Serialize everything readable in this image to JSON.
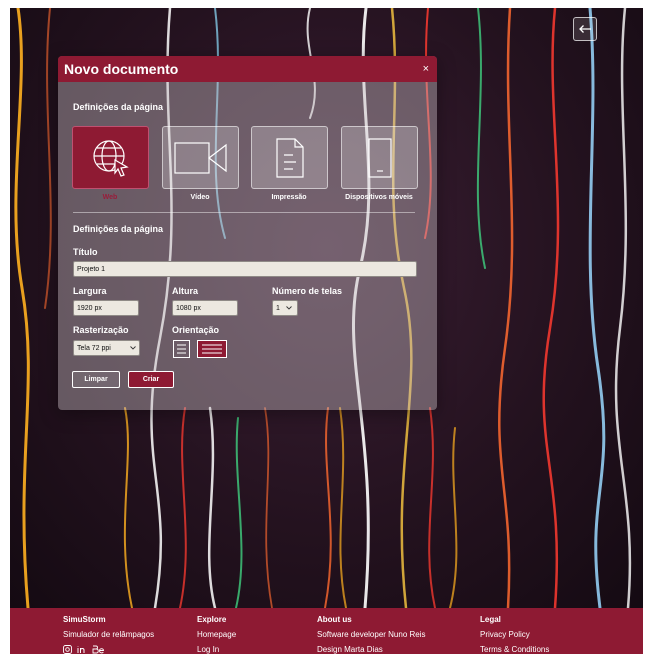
{
  "dialog": {
    "title": "Novo documento",
    "close": "×",
    "section_page_settings": "Definições da página",
    "section_page_settings_2": "Definições da página",
    "doc_types": [
      {
        "label": "Web",
        "icon": "web-cursor-icon",
        "selected": true
      },
      {
        "label": "Vídeo",
        "icon": "video-camera-icon",
        "selected": false
      },
      {
        "label": "Impressão",
        "icon": "document-icon",
        "selected": false
      },
      {
        "label": "Dispositivos móveis",
        "icon": "mobile-device-icon",
        "selected": false
      }
    ],
    "title_label": "Título",
    "title_value": "Projeto 1",
    "width_label": "Largura",
    "width_value": "1920 px",
    "height_label": "Altura",
    "height_value": "1080 px",
    "screens_label": "Número de telas",
    "screens_value": "1",
    "raster_label": "Rasterização",
    "raster_value": "Tela 72 ppi",
    "orientation_label": "Orientação",
    "orientation_options": [
      "portrait",
      "landscape"
    ],
    "orientation_selected": "landscape",
    "clear_label": "Limpar",
    "create_label": "Criar"
  },
  "footer": {
    "col1": {
      "heading": "SimuStorm",
      "links": [
        "Simulador de relâmpagos"
      ],
      "social_icons": [
        "instagram-icon",
        "linkedin-icon",
        "behance-icon"
      ]
    },
    "col2": {
      "heading": "Explore",
      "links": [
        "Homepage",
        "Log In"
      ]
    },
    "col3": {
      "heading": "About us",
      "links": [
        "Software developer Nuno Reis",
        "Design Marta Dias"
      ]
    },
    "col4": {
      "heading": "Legal",
      "links": [
        "Privacy Policy",
        "Terms & Conditions"
      ]
    }
  },
  "colors": {
    "accent": "#8e1a33",
    "input_bg": "#ece8e0"
  }
}
